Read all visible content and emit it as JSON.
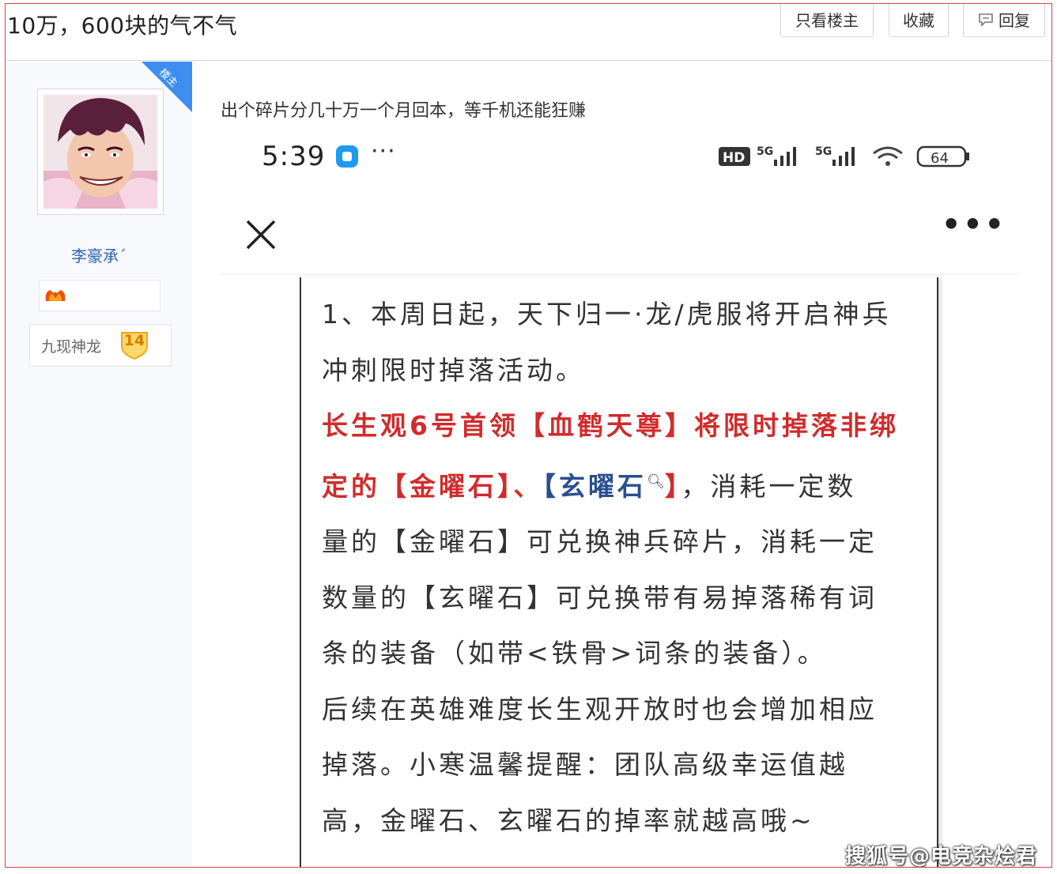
{
  "header": {
    "title": "10万，600块的气不气",
    "only_op_label": "只看楼主",
    "favorite_label": "收藏",
    "reply_label": "回复"
  },
  "user": {
    "op_badge": "楼主",
    "name": "李豪承´",
    "level_name": "九现神龙",
    "level": "14"
  },
  "post": {
    "text": "出个碎片分几十万一个月回本，等千机还能狂赚"
  },
  "screenshot": {
    "status_time": "5:39",
    "status_more": "···",
    "network_label": "5G",
    "network_label_2": "5G",
    "hd_label": "HD",
    "battery": "64",
    "nav_more": "•••"
  },
  "notice": {
    "line1": "1、本周日起，天下归一·龙/虎服将开启神兵",
    "line2": "冲刺限时掉落活动。",
    "line3": "长生观6号首领【血鹤天尊】将限时掉落非绑",
    "line4_red": "定的【金曜石】、",
    "line4_blue": "【玄曜石",
    "line4_blue_end": "】",
    "line4_rest": "，消耗一定数",
    "line5": "量的【金曜石】可兑换神兵碎片，消耗一定",
    "line6": "数量的【玄曜石】可兑换带有易掉落稀有词",
    "line7": "条的装备（如带<铁骨>词条的装备）。",
    "line8": "后续在英雄难度长生观开放时也会增加相应",
    "line9": "掉落。小寒温馨提醒：团队高级幸运值越",
    "line10": "高，金曜石、玄曜石的掉率就越高哦~"
  },
  "watermark": "搜狐号@电竞杂烩君",
  "colors": {
    "accent_blue": "#3e8ef0",
    "username_blue": "#2d64b3",
    "notice_red": "#d22b2b",
    "notice_blue": "#2a4f8f",
    "frame_red": "#e04040"
  }
}
